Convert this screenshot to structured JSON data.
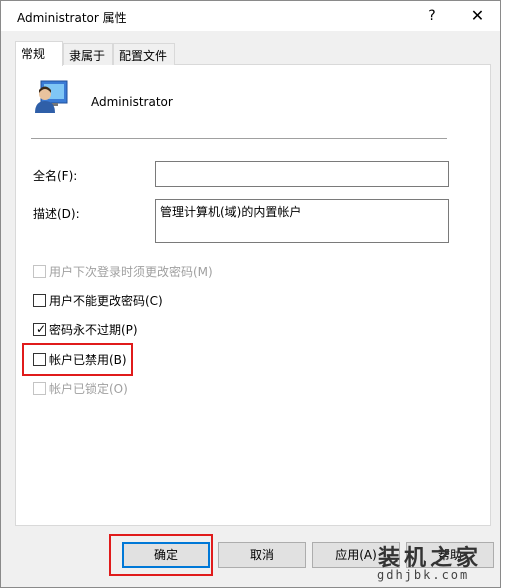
{
  "window": {
    "title": "Administrator 属性",
    "help_label": "?",
    "close_label": "✕"
  },
  "tabs": [
    {
      "label": "常规",
      "active": true
    },
    {
      "label": "隶属于",
      "active": false
    },
    {
      "label": "配置文件",
      "active": false
    }
  ],
  "general": {
    "user_icon": "user-icon",
    "username": "Administrator",
    "fullname_label": "全名(F):",
    "fullname_value": "",
    "description_label": "描述(D):",
    "description_value": "管理计算机(域)的内置帐户"
  },
  "checkboxes": [
    {
      "label": "用户下次登录时须更改密码(M)",
      "checked": false,
      "enabled": false
    },
    {
      "label": "用户不能更改密码(C)",
      "checked": false,
      "enabled": true
    },
    {
      "label": "密码永不过期(P)",
      "checked": true,
      "enabled": true
    },
    {
      "label": "帐户已禁用(B)",
      "checked": false,
      "enabled": true
    },
    {
      "label": "帐户已锁定(O)",
      "checked": false,
      "enabled": false
    }
  ],
  "buttons": {
    "ok": "确定",
    "cancel": "取消",
    "apply": "应用(A)",
    "help": "帮助"
  },
  "watermark": {
    "text": "装机之家",
    "url": "gdhjbk.com"
  },
  "colors": {
    "highlight": "#e01b1b",
    "accent": "#0078d7"
  }
}
